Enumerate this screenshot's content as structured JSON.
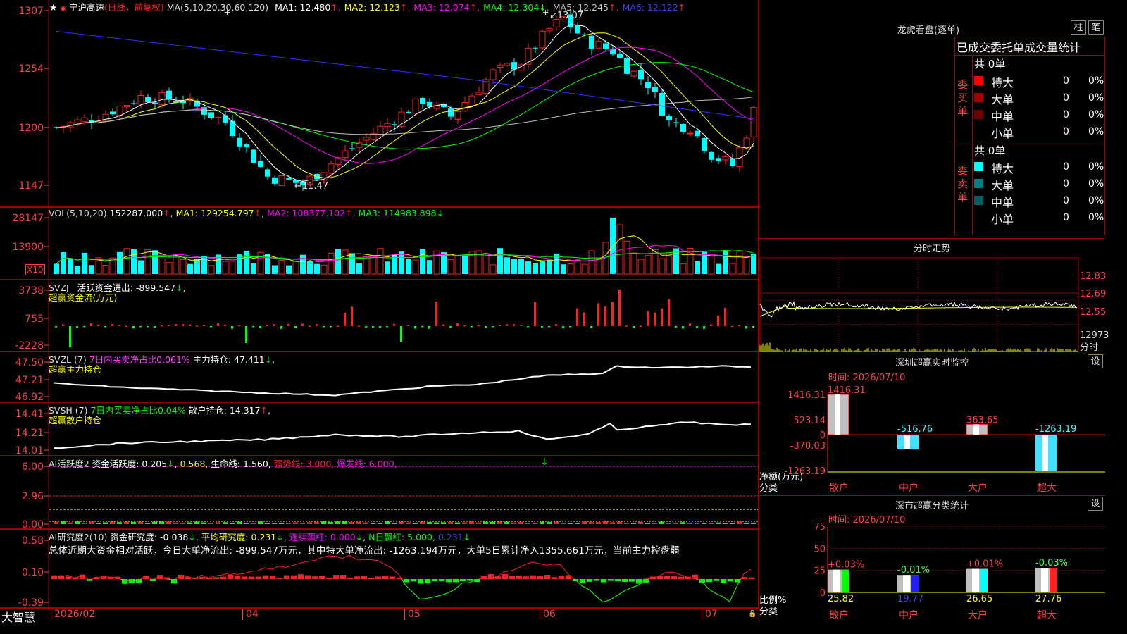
{
  "app": {
    "logo": "大智慧",
    "date_start": "2026/02"
  },
  "kline": {
    "header_name": "宁沪高速",
    "header_mode": "(日线，前复权)",
    "ma_params": "MA(5,10,20,30,60,120)",
    "ma": [
      {
        "label": "MA1:",
        "value": "12.480",
        "arrow": "↑",
        "color": "#ffffff"
      },
      {
        "label": "MA2:",
        "value": "12.123",
        "arrow": "↑",
        "color": "#ffff00"
      },
      {
        "label": "MA3:",
        "value": "12.074",
        "arrow": "↑",
        "color": "#ff00ff"
      },
      {
        "label": "MA4:",
        "value": "12.304",
        "arrow": "↓",
        "color": "#00ff00"
      },
      {
        "label": "MA5:",
        "value": "12.245",
        "arrow": "↑",
        "color": "#c0c0c0"
      },
      {
        "label": "MA6:",
        "value": "12.122",
        "arrow": "↑",
        "color": "#4040ff"
      }
    ],
    "yticks": [
      "1307",
      "1254",
      "1200",
      "1147"
    ],
    "high_label": "13.07",
    "low_label": "11.47"
  },
  "vol": {
    "header": "VOL(5,10,20)",
    "value": "152287.000",
    "ma1": "MA1: 129254.797",
    "ma2": "MA2: 108377.102",
    "ma3": "MA3: 114983.898",
    "yticks": [
      "28147",
      "13900"
    ],
    "unit": "X10"
  },
  "svzj": {
    "header": "SVZJ",
    "desc": "活跃资金进出: -899.547",
    "sub": "超赢资金流(万元)",
    "yticks": [
      "3738",
      "755",
      "-2228"
    ]
  },
  "svzl": {
    "header": "SVZL (7)",
    "desc1": "7日内买卖净占比0.061%",
    "desc2": "主力持仓: 47.411",
    "sub": "超赢主力持仓",
    "yticks": [
      "47.50",
      "47.21",
      "46.92"
    ]
  },
  "svsh": {
    "header": "SVSH (7)",
    "desc1": "7日内买卖净占比0.04%",
    "desc2": "散户持仓: 14.317",
    "sub": "超赢散户持仓",
    "yticks": [
      "14.41",
      "14.21",
      "14.01"
    ]
  },
  "ai1": {
    "header": "AI活跃度2",
    "d1": "资金活跃度: 0.205",
    "d2": "0.568,",
    "d3": "生命线: 1.560,",
    "d4": "强势线: 3.000,",
    "d5": "爆发线: 6.000,",
    "yticks": [
      "6.00",
      "2.96",
      "0.00"
    ]
  },
  "ai2": {
    "header": "AI研究度2(10)",
    "d1": "资金研究度: -0.038",
    "d2": "平均研究度: 0.231",
    "d3": "连续飘红: 0.000",
    "d4": "N日飘红: 5.000,",
    "d5": "0.231",
    "summary": "总体近期大资金相对活跃，今日大单净流出: -899.547万元，其中特大单净流出: -1263.194万元，大单5日累计净入1355.661万元，当前主力控盘弱",
    "yticks": [
      "0.58",
      "0.10",
      "-0.39"
    ]
  },
  "xaxis": [
    "04",
    "05",
    "06",
    "07"
  ],
  "dragon": {
    "title": "龙虎看盘(逐单)",
    "btn1": "柱",
    "btn2": "笔",
    "subtitle": "已成交委托单成交量统计",
    "buy_label": "委买单",
    "sell_label": "委卖单",
    "buy_total": "共 0单",
    "sell_total": "共 0单",
    "buy_rows": [
      {
        "name": "特大",
        "v": "0",
        "p": "0%",
        "color": "#ff0000"
      },
      {
        "name": "大单",
        "v": "0",
        "p": "0%",
        "color": "#a00000"
      },
      {
        "name": "中单",
        "v": "0",
        "p": "0%",
        "color": "#700000"
      },
      {
        "name": "小单",
        "v": "0",
        "p": "0%",
        "color": ""
      }
    ],
    "sell_rows": [
      {
        "name": "特大",
        "v": "0",
        "p": "0%",
        "color": "#00ffff"
      },
      {
        "name": "大单",
        "v": "0",
        "p": "0%",
        "color": "#008080"
      },
      {
        "name": "中单",
        "v": "0",
        "p": "0%",
        "color": "#006060"
      },
      {
        "name": "小单",
        "v": "0",
        "p": "0%",
        "color": ""
      }
    ]
  },
  "intraday": {
    "title": "分时走势",
    "yticks": [
      "12.83",
      "12.69",
      "12.55",
      "12973",
      "分时"
    ]
  },
  "sz_monitor": {
    "title": "深圳超赢实时监控",
    "btn": "设",
    "time": "时间: 2026/07/10",
    "yticks": [
      "1416.31",
      "523.14",
      "0",
      "-370.03",
      "-1263.19"
    ],
    "ylabel1": "净额(万元)",
    "ylabel2": "分类",
    "values": [
      {
        "cat": "散户",
        "v": 1416.31,
        "label": "1416.31"
      },
      {
        "cat": "中户",
        "v": -516.76,
        "label": "-516.76"
      },
      {
        "cat": "大户",
        "v": 363.65,
        "label": "363.65"
      },
      {
        "cat": "超大",
        "v": -1263.19,
        "label": "-1263.19"
      }
    ]
  },
  "sz_class": {
    "title": "深市超赢分类统计",
    "btn": "设",
    "time": "时间: 2026/07/10",
    "yticks": [
      "75",
      "50",
      "25",
      "0"
    ],
    "ylabel1": "比例%",
    "ylabel2": "分类",
    "values": [
      {
        "cat": "散户",
        "v": 25.82,
        "label": "25.82",
        "chg": "+0.03%",
        "color": "#00ff00"
      },
      {
        "cat": "中户",
        "v": 19.77,
        "label": "19.77",
        "chg": "-0.01%",
        "color": "#2020ff"
      },
      {
        "cat": "大户",
        "v": 26.65,
        "label": "26.65",
        "chg": "+0.01%",
        "color": "#00ffff"
      },
      {
        "cat": "超大",
        "v": 27.76,
        "label": "27.76",
        "chg": "-0.03%",
        "color": "#ff2020"
      }
    ]
  }
}
